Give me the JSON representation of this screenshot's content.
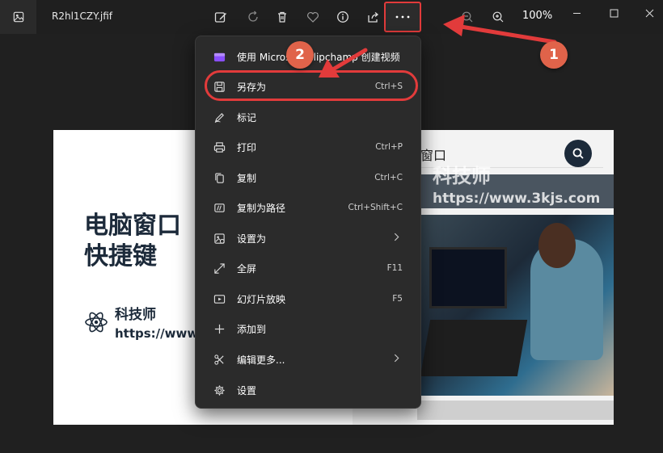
{
  "window": {
    "filename": "R2hl1CZY.jfif",
    "zoom": "100%"
  },
  "toolbar": {
    "icons": [
      "edit-image-icon",
      "rotate-icon",
      "delete-icon",
      "favorite-icon",
      "info-icon",
      "share-icon",
      "more-icon",
      "zoom-out-icon",
      "zoom-in-icon"
    ]
  },
  "menu": {
    "items": [
      {
        "label": "使用 Microsoft Clipchamp 创建视频",
        "shortcut": "",
        "icon": "clipchamp-icon"
      },
      {
        "label": "另存为",
        "shortcut": "Ctrl+S",
        "icon": "save-icon"
      },
      {
        "label": "标记",
        "shortcut": "",
        "icon": "markup-icon"
      },
      {
        "label": "打印",
        "shortcut": "Ctrl+P",
        "icon": "print-icon"
      },
      {
        "label": "复制",
        "shortcut": "Ctrl+C",
        "icon": "copy-icon"
      },
      {
        "label": "复制为路径",
        "shortcut": "Ctrl+Shift+C",
        "icon": "copy-path-icon"
      },
      {
        "label": "设置为",
        "shortcut": "",
        "icon": "set-as-icon",
        "submenu": true
      },
      {
        "label": "全屏",
        "shortcut": "F11",
        "icon": "fullscreen-icon"
      },
      {
        "label": "幻灯片放映",
        "shortcut": "F5",
        "icon": "slideshow-icon"
      },
      {
        "label": "添加到",
        "shortcut": "",
        "icon": "add-icon"
      },
      {
        "label": "编辑更多...",
        "shortcut": "",
        "icon": "edit-more-icon",
        "submenu": true
      },
      {
        "label": "设置",
        "shortcut": "",
        "icon": "settings-icon"
      }
    ]
  },
  "image": {
    "title_line1": "电脑窗口",
    "title_line2": "快捷键",
    "brand_name": "科技师",
    "brand_url": "https://www",
    "search_text": "窗口",
    "watermark_name": "科技师",
    "watermark_url": "https://www.3kjs.com"
  },
  "annotations": {
    "step1": "1",
    "step2": "2"
  },
  "colors": {
    "highlight": "#e23b3b",
    "badge": "#e0634a"
  }
}
